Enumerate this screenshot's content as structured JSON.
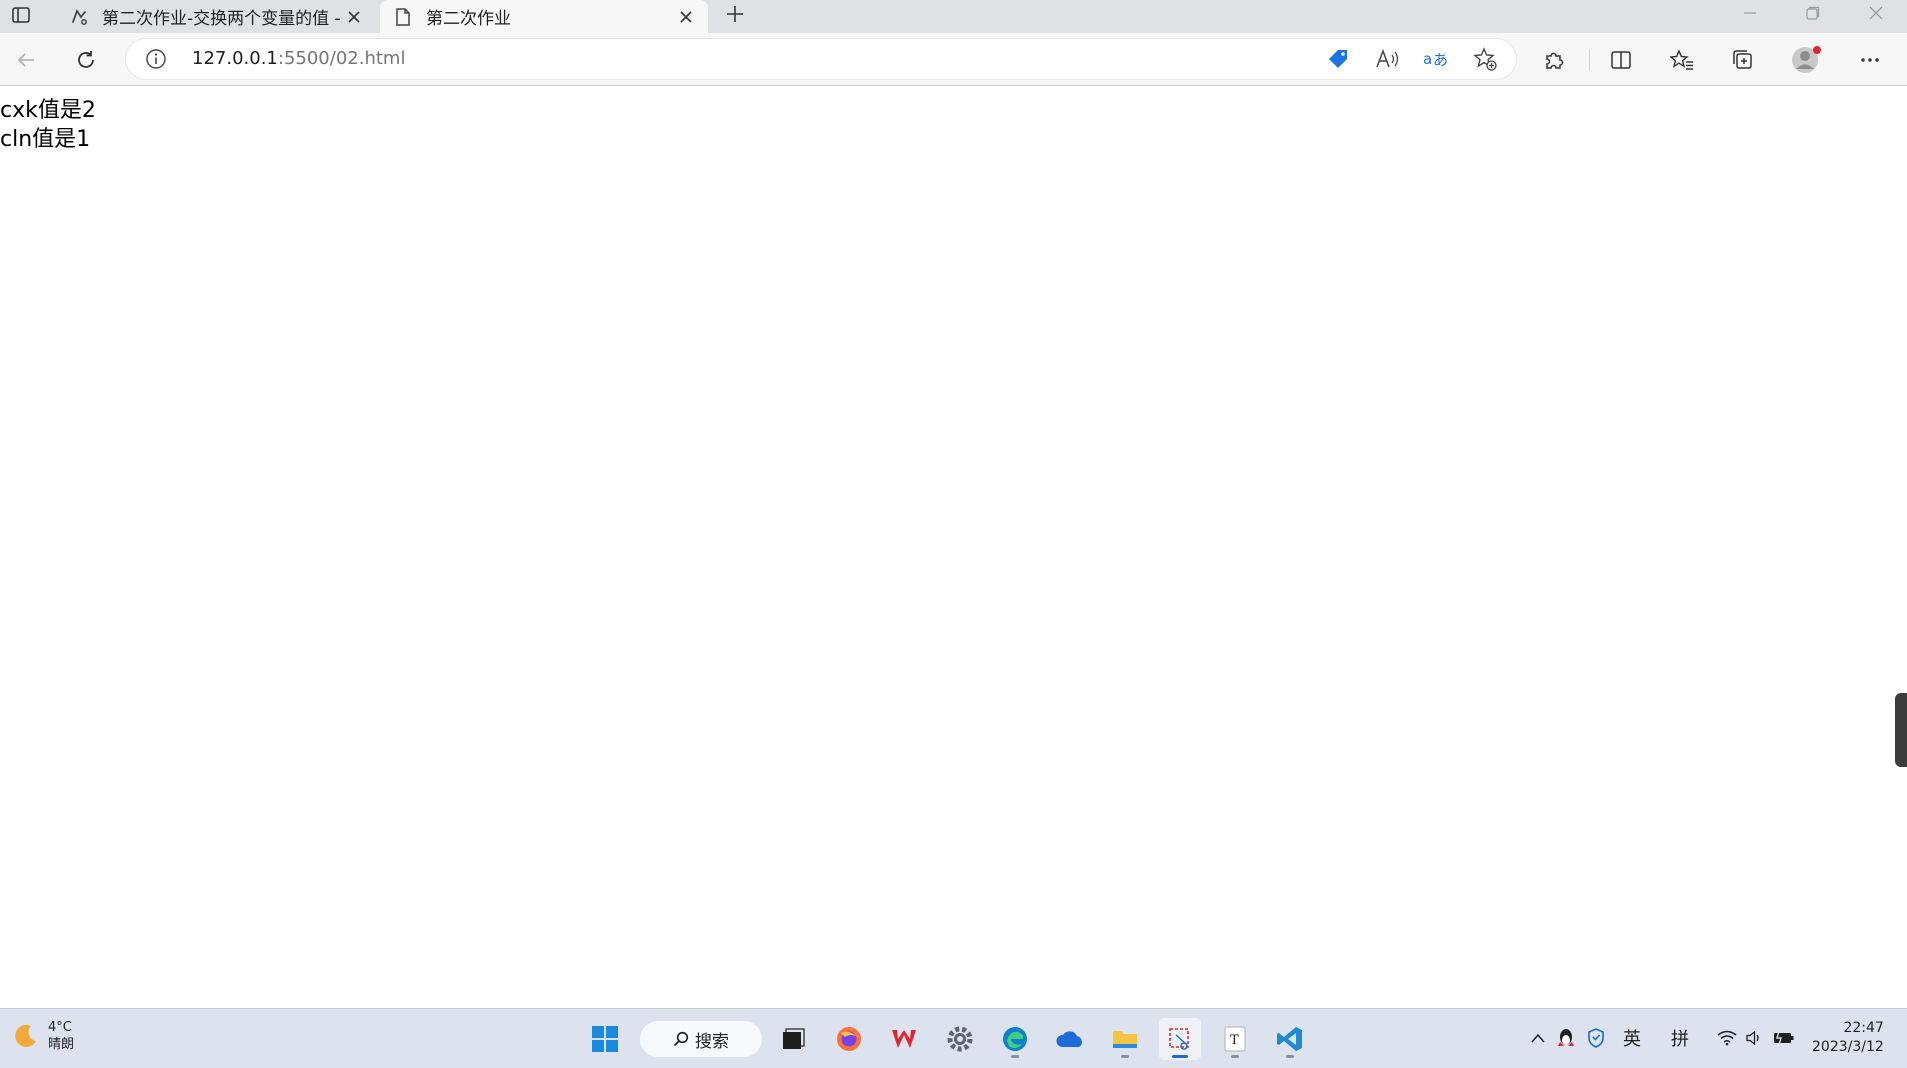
{
  "tabs": [
    {
      "title": "第二次作业-交换两个变量的值 -",
      "active": false
    },
    {
      "title": "第二次作业",
      "active": true
    }
  ],
  "address": {
    "host": "127.0.0.1",
    "path": ":5500/02.html"
  },
  "page": {
    "lines": [
      "cxk值是2",
      "cln值是1"
    ]
  },
  "taskbar": {
    "weather_temp": "4°C",
    "weather_desc": "晴朗",
    "search_label": "搜索",
    "ime_lang": "英",
    "ime_mode": "拼",
    "time": "22:47",
    "date": "2023/3/12"
  },
  "colors": {
    "accent": "#1c6bd6",
    "tabstrip_bg": "#dfe1e4",
    "toolbar_bg": "#f7f7f7",
    "taskbar_bg": "#dde3ee"
  }
}
